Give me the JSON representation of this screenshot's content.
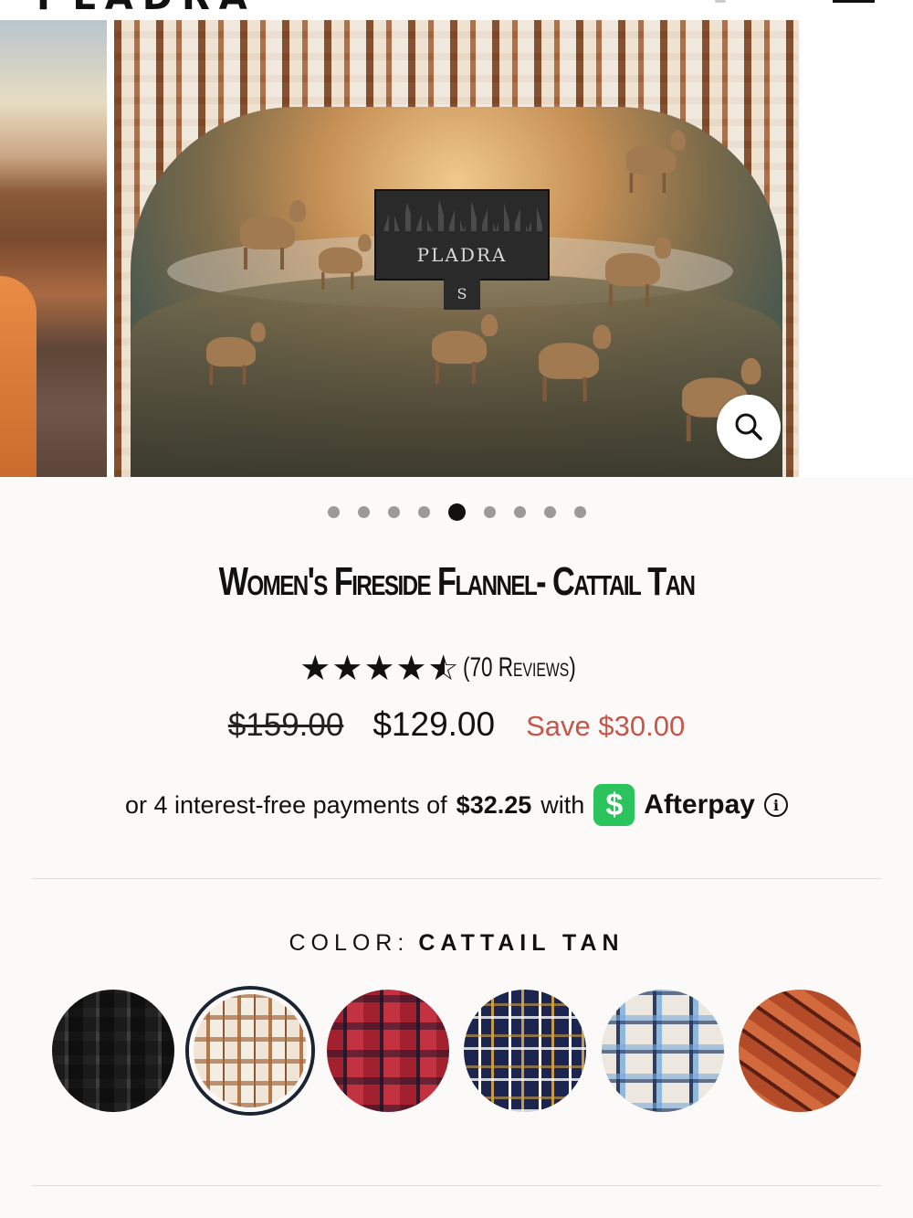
{
  "header": {
    "logo_text": "PLADRA"
  },
  "gallery": {
    "label_brand": "PLADRA",
    "label_size": "S",
    "dots_count": 9,
    "active_dot_index": 4
  },
  "product": {
    "title": "Women's Fireside Flannel- Cattail Tan",
    "rating": 4.5,
    "reviews_text": "(70 Reviews)",
    "price_original": "$159.00",
    "price_current": "$129.00",
    "price_save": "Save $30.00"
  },
  "afterpay": {
    "prefix": "or 4 interest-free payments of",
    "amount": "$32.25",
    "with": "with",
    "logo_glyph": "$",
    "name": "Afterpay",
    "info_glyph": "i"
  },
  "color": {
    "label": "COLOR:",
    "selected": "CATTAIL TAN",
    "swatches": [
      "charcoal",
      "cattail-tan",
      "red",
      "navy",
      "blue",
      "rust"
    ],
    "selected_index": 1
  },
  "colors": {
    "save_red": "#c8554a",
    "afterpay_green": "#2bc35c",
    "selected_ring": "#1c2433"
  }
}
